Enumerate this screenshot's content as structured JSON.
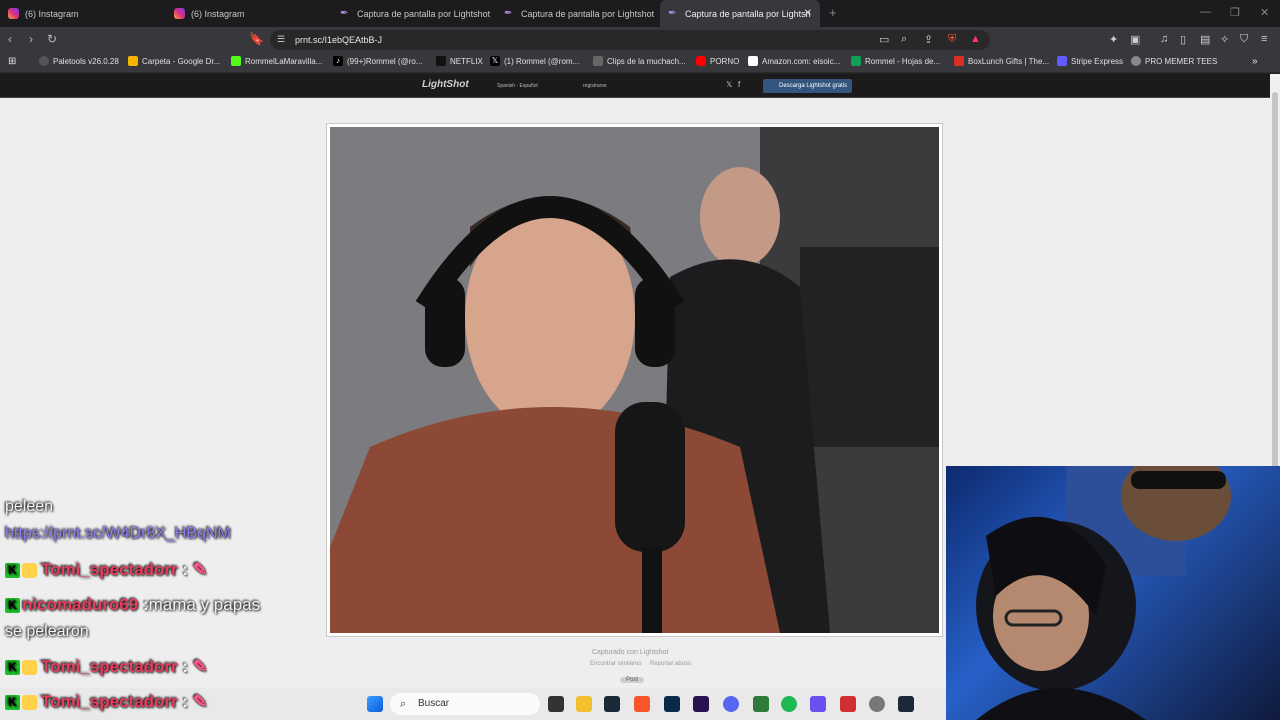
{
  "tabs": [
    {
      "label": "(6) Instagram"
    },
    {
      "label": "(6) Instagram"
    },
    {
      "label": "Captura de pantalla por Lightshot"
    },
    {
      "label": "Captura de pantalla por Lightshot"
    },
    {
      "label": "Captura de pantalla por Lightsh"
    }
  ],
  "address": {
    "url": "prnt.sc/I1ebQEAtbB-J"
  },
  "bookmarks": [
    {
      "label": "Paletools v26.0.28",
      "color": "#555555"
    },
    {
      "label": "Carpeta - Google Dr...",
      "color": "#f4b400"
    },
    {
      "label": "RommelLaMaravilla...",
      "color": "#53fc18"
    },
    {
      "label": "(99+)Rommel (@ro...",
      "color": "#222222"
    },
    {
      "label": "NETFLIX",
      "color": "#111111"
    },
    {
      "label": "(1) Rommel (@rom...",
      "color": "#111111"
    },
    {
      "label": "Clips de la muchach...",
      "color": "#666666"
    },
    {
      "label": "PORNO",
      "color": "#ff0000"
    },
    {
      "label": "Amazon.com: eisoic...",
      "color": "#ffffff"
    },
    {
      "label": "Rommel - Hojas de...",
      "color": "#0f9d58"
    },
    {
      "label": "BoxLunch Gifts | The...",
      "color": "#d93025"
    },
    {
      "label": "Stripe Express",
      "color": "#635bff"
    },
    {
      "label": "PRO MEMER TEES",
      "color": "#888888"
    }
  ],
  "lightshot": {
    "logo": "LightShot",
    "language": "Spanish - Español",
    "register": "registrarse",
    "download": "Descarga Lightshot gratis",
    "captured": "Capturado con Lightshot",
    "similar": "Encontrar similares",
    "report": "Reportar abuso",
    "post": "Post"
  },
  "chat": [
    {
      "text": "peleen"
    },
    {
      "text": "https://prnt.sc/W4Dr8X_HBqNM"
    },
    {
      "badge": "K",
      "user": "Tomi_spectadorr",
      "sep": ":",
      "msg": ""
    },
    {
      "badge": "K",
      "user": "nicomaduro69",
      "sep": ":",
      "msg": "mama y papas"
    },
    {
      "text": "se pelearon"
    },
    {
      "badge": "K",
      "user": "Tomi_spectadorr",
      "sep": ":",
      "msg": ""
    },
    {
      "badge": "K",
      "user": "Tomi_spectadorr",
      "sep": ":",
      "msg": ""
    }
  ],
  "taskbar": {
    "search": "Buscar"
  }
}
